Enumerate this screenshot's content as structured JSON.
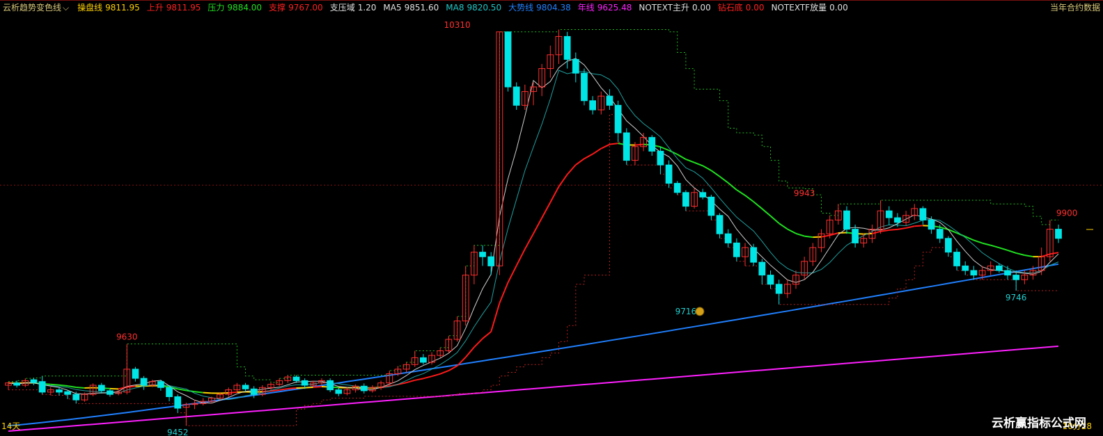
{
  "legend": {
    "title": "云析趋势变色线",
    "title_color": "#d6c77a",
    "items": [
      {
        "label": "操盘线",
        "value": "9811.95",
        "label_color": "#ffd200",
        "value_color": "#ffd200"
      },
      {
        "label": "上升",
        "value": "9811.95",
        "label_color": "#ff2020",
        "value_color": "#ff2020"
      },
      {
        "label": "压力",
        "value": "9884.00",
        "label_color": "#20e020",
        "value_color": "#20e020"
      },
      {
        "label": "支撑",
        "value": "9767.00",
        "label_color": "#ff2020",
        "value_color": "#ff2020"
      },
      {
        "label": "支压域",
        "value": "1.20",
        "label_color": "#e0e0e0",
        "value_color": "#e0e0e0"
      },
      {
        "label": "MA5",
        "value": "9851.60",
        "label_color": "#e0e0e0",
        "value_color": "#e0e0e0"
      },
      {
        "label": "MA8",
        "value": "9820.50",
        "label_color": "#20c8c8",
        "value_color": "#20c8c8"
      },
      {
        "label": "大势线",
        "value": "9804.38",
        "label_color": "#2080ff",
        "value_color": "#2080ff"
      },
      {
        "label": "年线",
        "value": "9625.48",
        "label_color": "#ff20ff",
        "value_color": "#ff20ff"
      },
      {
        "label": "NOTEXT主升",
        "value": "0.00",
        "label_color": "#e0e0e0",
        "value_color": "#e0e0e0"
      },
      {
        "label": "钻石底",
        "value": "0.00",
        "label_color": "#ff2020",
        "value_color": "#ff2020"
      },
      {
        "label": "NOTEXTF放量",
        "value": "0.00",
        "label_color": "#e0e0e0",
        "value_color": "#e0e0e0"
      }
    ]
  },
  "corner_top_right": "当年合约数据",
  "corner_bottom_left": "14天",
  "corner_bottom_right": "10分28",
  "watermark": "云析赢指标公式网",
  "colors": {
    "up_candle": "#ff3030",
    "down_candle": "#00e5e5",
    "ma_white": "#d0d0d0",
    "ma_teal": "#20a0a0",
    "red_line": "#ff1a1a",
    "green_line": "#20e020",
    "yellow_line": "#ffd200",
    "blue_line": "#2080ff",
    "magenta_line": "#ff20ff",
    "dotted_green": "#20c020",
    "dotted_red": "#c02020",
    "ref_line": "#8a1010"
  },
  "chart_data": {
    "type": "candlestick",
    "y_range": [
      9440,
      10340
    ],
    "high_low_labels": [
      {
        "text": "10310",
        "price": 10310,
        "bar": 53,
        "kind": "high"
      },
      {
        "text": "9630",
        "price": 9630,
        "bar": 14,
        "kind": "high"
      },
      {
        "text": "9452",
        "price": 9452,
        "bar": 20,
        "kind": "low"
      },
      {
        "text": "9943",
        "price": 9943,
        "bar": 94,
        "kind": "high"
      },
      {
        "text": "9716",
        "price": 9716,
        "bar": 80,
        "kind": "low"
      },
      {
        "text": "9900",
        "price": 9900,
        "bar": 125,
        "kind": "high"
      },
      {
        "text": "9746",
        "price": 9746,
        "bar": 119,
        "kind": "low"
      }
    ],
    "reference_price": 9976,
    "candles": [
      [
        9540,
        9545,
        9530,
        9548
      ],
      [
        9545,
        9540,
        9535,
        9550
      ],
      [
        9540,
        9550,
        9536,
        9555
      ],
      [
        9552,
        9546,
        9540,
        9556
      ],
      [
        9548,
        9525,
        9520,
        9560
      ],
      [
        9525,
        9530,
        9518,
        9536
      ],
      [
        9530,
        9525,
        9518,
        9535
      ],
      [
        9526,
        9520,
        9510,
        9530
      ],
      [
        9520,
        9508,
        9500,
        9526
      ],
      [
        9508,
        9520,
        9504,
        9524
      ],
      [
        9520,
        9540,
        9516,
        9544
      ],
      [
        9540,
        9528,
        9522,
        9545
      ],
      [
        9528,
        9520,
        9515,
        9532
      ],
      [
        9522,
        9525,
        9518,
        9530
      ],
      [
        9525,
        9575,
        9520,
        9630
      ],
      [
        9575,
        9555,
        9548,
        9580
      ],
      [
        9555,
        9540,
        9530,
        9560
      ],
      [
        9540,
        9548,
        9536,
        9552
      ],
      [
        9548,
        9535,
        9528,
        9552
      ],
      [
        9535,
        9515,
        9505,
        9540
      ],
      [
        9515,
        9490,
        9480,
        9520
      ],
      [
        9492,
        9498,
        9452,
        9502
      ],
      [
        9498,
        9500,
        9488,
        9508
      ],
      [
        9500,
        9505,
        9496,
        9512
      ],
      [
        9505,
        9512,
        9500,
        9515
      ],
      [
        9512,
        9520,
        9508,
        9525
      ],
      [
        9520,
        9530,
        9515,
        9535
      ],
      [
        9530,
        9540,
        9524,
        9545
      ],
      [
        9540,
        9532,
        9526,
        9545
      ],
      [
        9532,
        9520,
        9512,
        9538
      ],
      [
        9520,
        9535,
        9516,
        9540
      ],
      [
        9535,
        9542,
        9530,
        9546
      ],
      [
        9542,
        9550,
        9538,
        9555
      ],
      [
        9550,
        9558,
        9545,
        9562
      ],
      [
        9558,
        9550,
        9545,
        9562
      ],
      [
        9550,
        9540,
        9532,
        9555
      ],
      [
        9540,
        9545,
        9536,
        9550
      ],
      [
        9545,
        9550,
        9540,
        9555
      ],
      [
        9550,
        9530,
        9525,
        9555
      ],
      [
        9530,
        9522,
        9516,
        9535
      ],
      [
        9522,
        9530,
        9518,
        9535
      ],
      [
        9530,
        9538,
        9524,
        9542
      ],
      [
        9538,
        9528,
        9522,
        9544
      ],
      [
        9528,
        9535,
        9524,
        9540
      ],
      [
        9535,
        9545,
        9530,
        9550
      ],
      [
        9545,
        9565,
        9540,
        9572
      ],
      [
        9565,
        9575,
        9560,
        9582
      ],
      [
        9575,
        9585,
        9568,
        9590
      ],
      [
        9585,
        9600,
        9580,
        9615
      ],
      [
        9600,
        9590,
        9585,
        9608
      ],
      [
        9590,
        9605,
        9585,
        9612
      ],
      [
        9605,
        9615,
        9600,
        9622
      ],
      [
        9615,
        9640,
        9610,
        9648
      ],
      [
        9640,
        9680,
        9635,
        9690
      ],
      [
        9680,
        9780,
        9670,
        9800
      ],
      [
        9780,
        9830,
        9760,
        9845
      ],
      [
        9830,
        9820,
        9800,
        9845
      ],
      [
        9820,
        9800,
        9780,
        9830
      ],
      [
        9800,
        10310,
        9780,
        10310
      ],
      [
        10310,
        10190,
        10180,
        10310
      ],
      [
        10190,
        10150,
        10140,
        10200
      ],
      [
        10150,
        10180,
        10140,
        10195
      ],
      [
        10180,
        10190,
        10150,
        10200
      ],
      [
        10190,
        10230,
        10170,
        10240
      ],
      [
        10230,
        10260,
        10210,
        10280
      ],
      [
        10260,
        10300,
        10240,
        10315
      ],
      [
        10300,
        10250,
        10230,
        10310
      ],
      [
        10250,
        10220,
        10200,
        10265
      ],
      [
        10220,
        10160,
        10150,
        10230
      ],
      [
        10160,
        10140,
        10130,
        10170
      ],
      [
        10140,
        10170,
        10130,
        10180
      ],
      [
        10170,
        10150,
        10140,
        10185
      ],
      [
        10150,
        10090,
        10070,
        10160
      ],
      [
        10090,
        10030,
        10020,
        10100
      ],
      [
        10030,
        10060,
        10020,
        10070
      ],
      [
        10060,
        10080,
        10050,
        10090
      ],
      [
        10080,
        10050,
        10040,
        10085
      ],
      [
        10050,
        10020,
        10000,
        10060
      ],
      [
        10020,
        9980,
        9970,
        10030
      ],
      [
        9980,
        9960,
        9955,
        9985
      ],
      [
        9960,
        9930,
        9920,
        9965
      ],
      [
        9930,
        9960,
        9925,
        9970
      ],
      [
        9960,
        9950,
        9945,
        9968
      ],
      [
        9950,
        9910,
        9900,
        9955
      ],
      [
        9910,
        9870,
        9860,
        9915
      ],
      [
        9870,
        9850,
        9840,
        9880
      ],
      [
        9850,
        9820,
        9810,
        9860
      ],
      [
        9820,
        9840,
        9800,
        9850
      ],
      [
        9840,
        9808,
        9800,
        9848
      ],
      [
        9808,
        9780,
        9760,
        9815
      ],
      [
        9780,
        9760,
        9750,
        9790
      ],
      [
        9760,
        9740,
        9716,
        9770
      ],
      [
        9740,
        9760,
        9730,
        9770
      ],
      [
        9760,
        9780,
        9750,
        9790
      ],
      [
        9780,
        9810,
        9770,
        9820
      ],
      [
        9810,
        9840,
        9800,
        9850
      ],
      [
        9840,
        9870,
        9830,
        9880
      ],
      [
        9870,
        9900,
        9860,
        9910
      ],
      [
        9900,
        9920,
        9890,
        9935
      ],
      [
        9920,
        9880,
        9870,
        9930
      ],
      [
        9880,
        9850,
        9840,
        9890
      ],
      [
        9850,
        9860,
        9840,
        9870
      ],
      [
        9860,
        9880,
        9850,
        9890
      ],
      [
        9880,
        9920,
        9870,
        9943
      ],
      [
        9920,
        9905,
        9890,
        9930
      ],
      [
        9905,
        9895,
        9885,
        9915
      ],
      [
        9895,
        9910,
        9888,
        9920
      ],
      [
        9910,
        9925,
        9900,
        9935
      ],
      [
        9925,
        9900,
        9890,
        9930
      ],
      [
        9900,
        9880,
        9870,
        9908
      ],
      [
        9880,
        9860,
        9850,
        9890
      ],
      [
        9860,
        9830,
        9820,
        9865
      ],
      [
        9830,
        9800,
        9790,
        9838
      ],
      [
        9800,
        9790,
        9780,
        9810
      ],
      [
        9790,
        9780,
        9770,
        9800
      ],
      [
        9780,
        9790,
        9770,
        9800
      ],
      [
        9790,
        9800,
        9780,
        9810
      ],
      [
        9800,
        9790,
        9785,
        9805
      ],
      [
        9790,
        9780,
        9770,
        9800
      ],
      [
        9780,
        9770,
        9746,
        9790
      ],
      [
        9770,
        9780,
        9760,
        9790
      ],
      [
        9780,
        9790,
        9770,
        9800
      ],
      [
        9790,
        9820,
        9780,
        9840
      ],
      [
        9820,
        9880,
        9810,
        9900
      ],
      [
        9880,
        9860,
        9850,
        9890
      ]
    ],
    "overlay_series": [
      {
        "name": "操盘线",
        "color": "#ffd200"
      },
      {
        "name": "上升",
        "color": "#ff1a1a"
      },
      {
        "name": "压力",
        "color": "#20e020"
      },
      {
        "name": "支撑",
        "color": "#ff2020"
      },
      {
        "name": "MA5",
        "color": "#d0d0d0"
      },
      {
        "name": "MA8",
        "color": "#20a0a0"
      },
      {
        "name": "大势线",
        "color": "#2080ff"
      },
      {
        "name": "年线",
        "color": "#ff20ff"
      }
    ]
  }
}
